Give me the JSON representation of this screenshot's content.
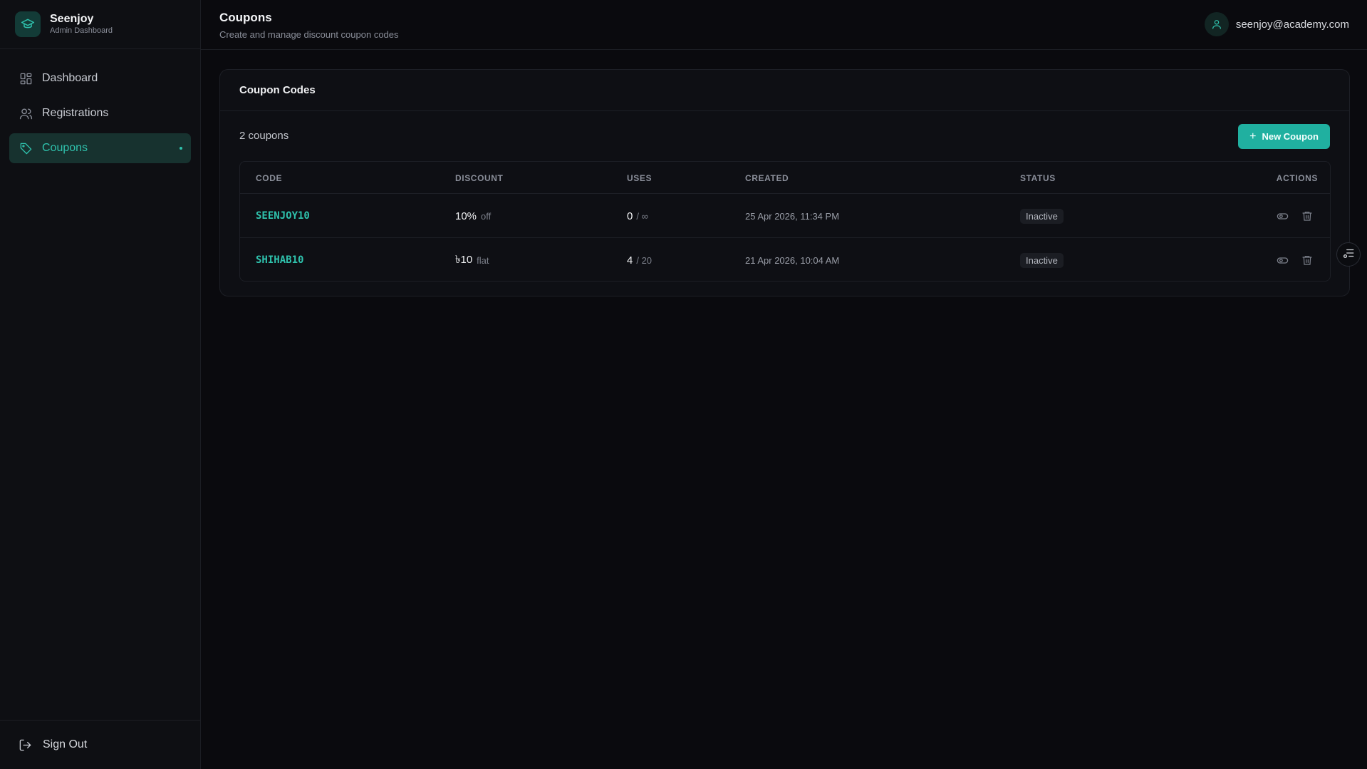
{
  "brand": {
    "name": "Seenjoy",
    "subtitle": "Admin Dashboard"
  },
  "sidebar": {
    "items": [
      {
        "label": "Dashboard",
        "icon": "grid-icon",
        "active": false
      },
      {
        "label": "Registrations",
        "icon": "users-icon",
        "active": false
      },
      {
        "label": "Coupons",
        "icon": "tag-icon",
        "active": true
      }
    ],
    "signout_label": "Sign Out"
  },
  "header": {
    "title": "Coupons",
    "subtitle": "Create and manage discount coupon codes",
    "user_email": "seenjoy@academy.com"
  },
  "card": {
    "title": "Coupon Codes",
    "count_label": "2 coupons",
    "new_button_label": "New Coupon",
    "columns": [
      "CODE",
      "DISCOUNT",
      "USES",
      "CREATED",
      "STATUS",
      "ACTIONS"
    ],
    "rows": [
      {
        "code": "SEENJOY10",
        "discount_value": "10%",
        "discount_unit": "off",
        "uses_count": "0",
        "uses_limit": "/ ∞",
        "created": "25 Apr 2026, 11:34 PM",
        "status": "Inactive"
      },
      {
        "code": "SHIHAB10",
        "discount_value": "৳10",
        "discount_unit": "flat",
        "uses_count": "4",
        "uses_limit": "/ 20",
        "created": "21 Apr 2026, 10:04 AM",
        "status": "Inactive"
      }
    ]
  },
  "colors": {
    "accent": "#2fc2ad",
    "button": "#20b0a0",
    "background": "#0a0a0e",
    "sidebar": "#0e0f13"
  }
}
